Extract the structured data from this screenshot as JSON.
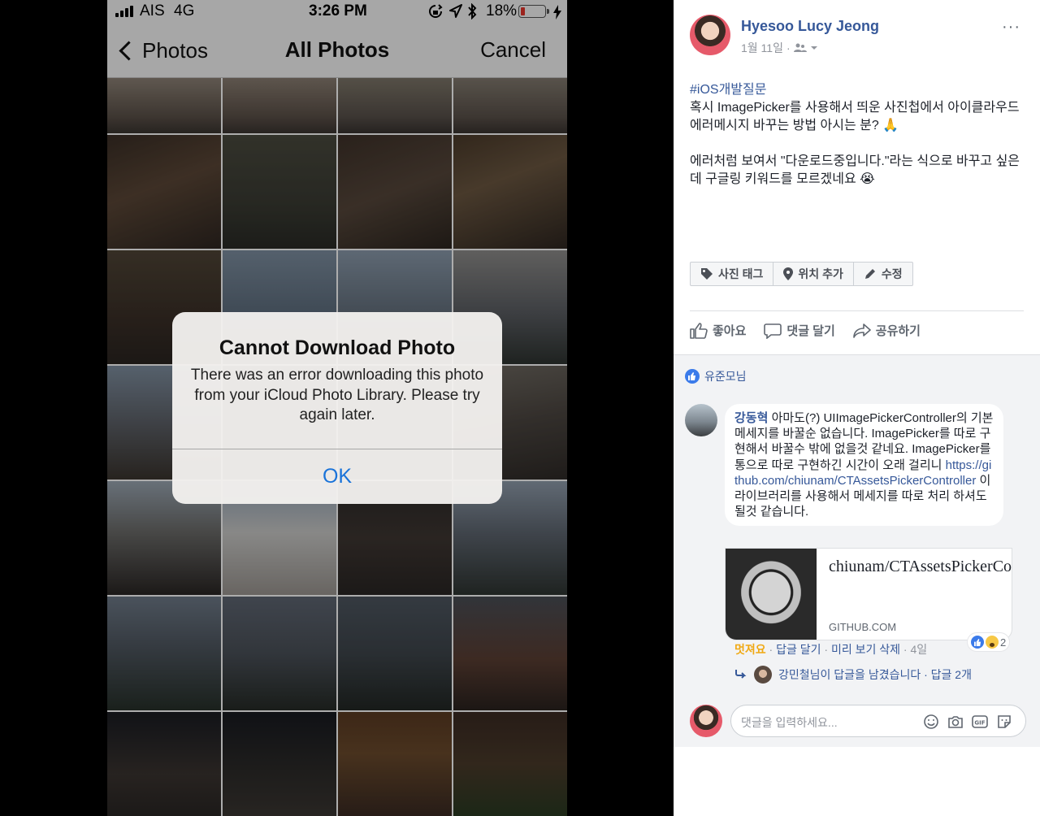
{
  "status_bar": {
    "carrier": "AIS",
    "network": "4G",
    "time": "3:26 PM",
    "battery": "18%",
    "battery_level": 0.18,
    "icons": [
      "signal-icon",
      "lock-rotation-icon",
      "location-icon",
      "bluetooth-icon",
      "battery-icon",
      "charging-icon"
    ]
  },
  "nav": {
    "back_label": "Photos",
    "title": "All Photos",
    "cancel_label": "Cancel"
  },
  "alert": {
    "title": "Cannot Download Photo",
    "message": "There was an error downloading this photo from your iCloud Photo Library. Please try again later.",
    "ok_label": "OK"
  },
  "post": {
    "author": "Hyesoo Lucy Jeong",
    "date": "1월 11일",
    "more": "···",
    "hashtag": "#iOS개발질문",
    "line1": "혹시 ImagePicker를 사용해서 띄운 사진첩에서 아이클라우드 에러메시지 바꾸는 방법 아시는 분? 🙏",
    "line2": "에러처럼 보여서 \"다운로드중입니다.\"라는 식으로 바꾸고 싶은데 구글링 키워드를 모르겠네요 😭",
    "tags": {
      "photo_tag": "사진 태그",
      "location": "위치 추가",
      "edit": "수정"
    },
    "actions": {
      "like": "좋아요",
      "comment": "댓글 달기",
      "share": "공유하기"
    }
  },
  "comments": {
    "follower_label": "유준모님",
    "comment": {
      "name": "강동혁",
      "text_before_link": "아마도(?) UIImagePickerController의 기본 메세지를 바꿀순 없습니다. ImagePicker를 따로 구현해서 바꿀수 밖에 없을것 같네요. ImagePicker를 통으로 따로 구현하긴 시간이 오래 걸리니",
      "link": "https://github.com/chiunam/CTAssetsPickerController",
      "text_after_link": "이 라이브러리를 사용해서 메세지를 따로 처리 하셔도 될것 같습니다."
    },
    "link_card": {
      "title": "chiunam/CTAssetsPickerController",
      "domain": "GITHUB.COM"
    },
    "reactions_count": "2",
    "comment_actions": {
      "amazed": "멋져요",
      "reply": "답글 달기",
      "remove_preview": "미리 보기 삭제",
      "time": "4일"
    },
    "reply_summary": "강민철님이 답글을 남겼습니다 · 답글 2개",
    "composer_placeholder": "댓글을 입력하세요..."
  }
}
